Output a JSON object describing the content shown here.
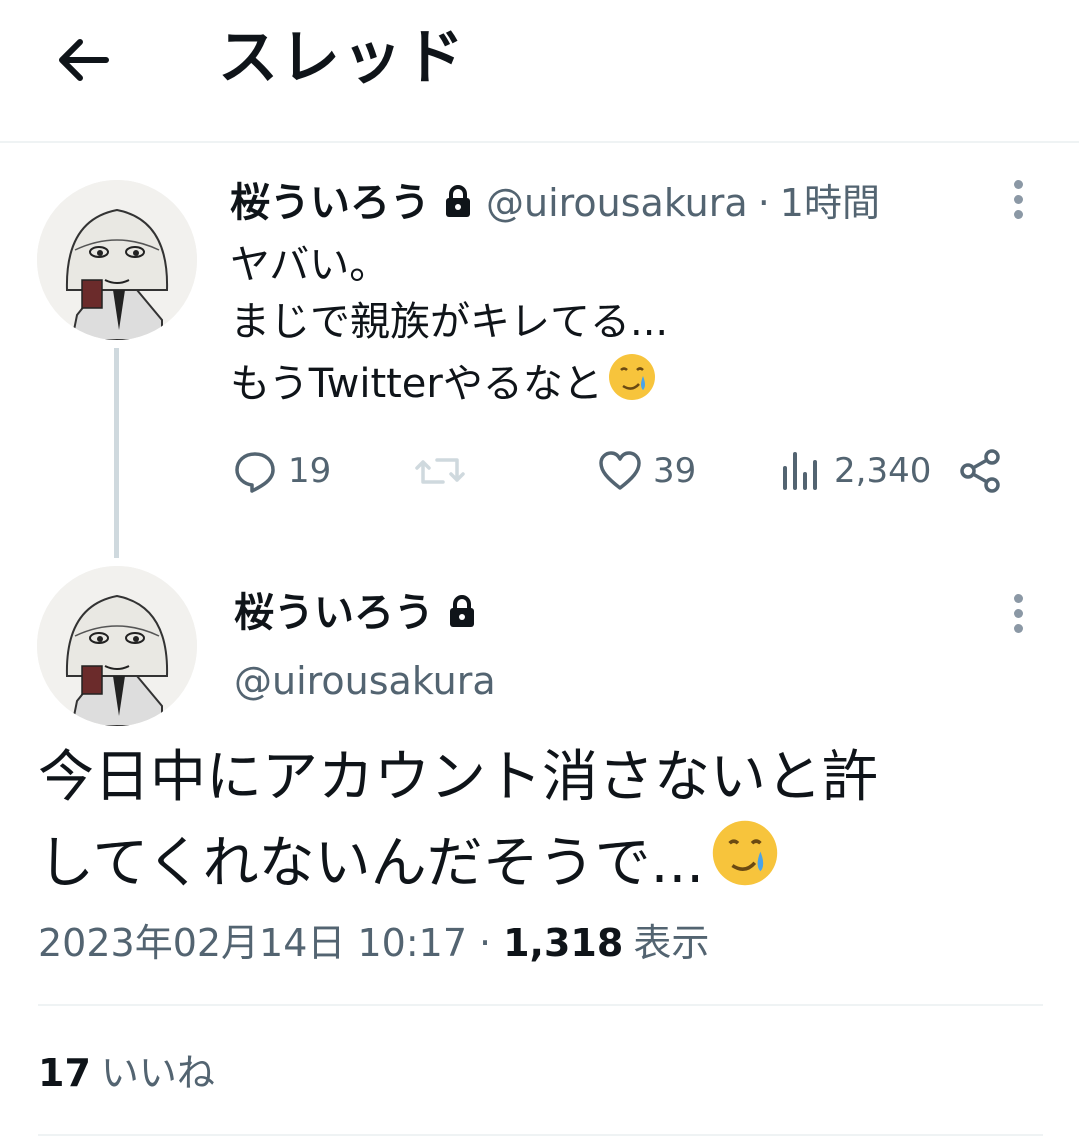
{
  "header": {
    "title": "スレッド"
  },
  "tweet1": {
    "name": "桜ういろう",
    "handle": "@uirousakura",
    "sep": "·",
    "time": "1時間",
    "lines": [
      "ヤバい。",
      "まじで親族がキレてる...",
      "もうTwitterやるなと"
    ],
    "emoji": "face-holding-back-tears",
    "replies": "19",
    "likes": "39",
    "views": "2,340"
  },
  "tweet2": {
    "name": "桜ういろう",
    "handle": "@uirousakura",
    "lines": [
      "今日中にアカウント消さないと許",
      "してくれないんだそうで..."
    ],
    "emoji": "face-holding-back-tears",
    "date": "2023年02月14日 10:17",
    "sep": "·",
    "views_count": "1,318",
    "views_label": "表示",
    "likes_count": "17",
    "likes_label": "いいね"
  },
  "colors": {
    "text": "#0f1419",
    "muted": "#536471",
    "divider": "#eff3f4"
  }
}
